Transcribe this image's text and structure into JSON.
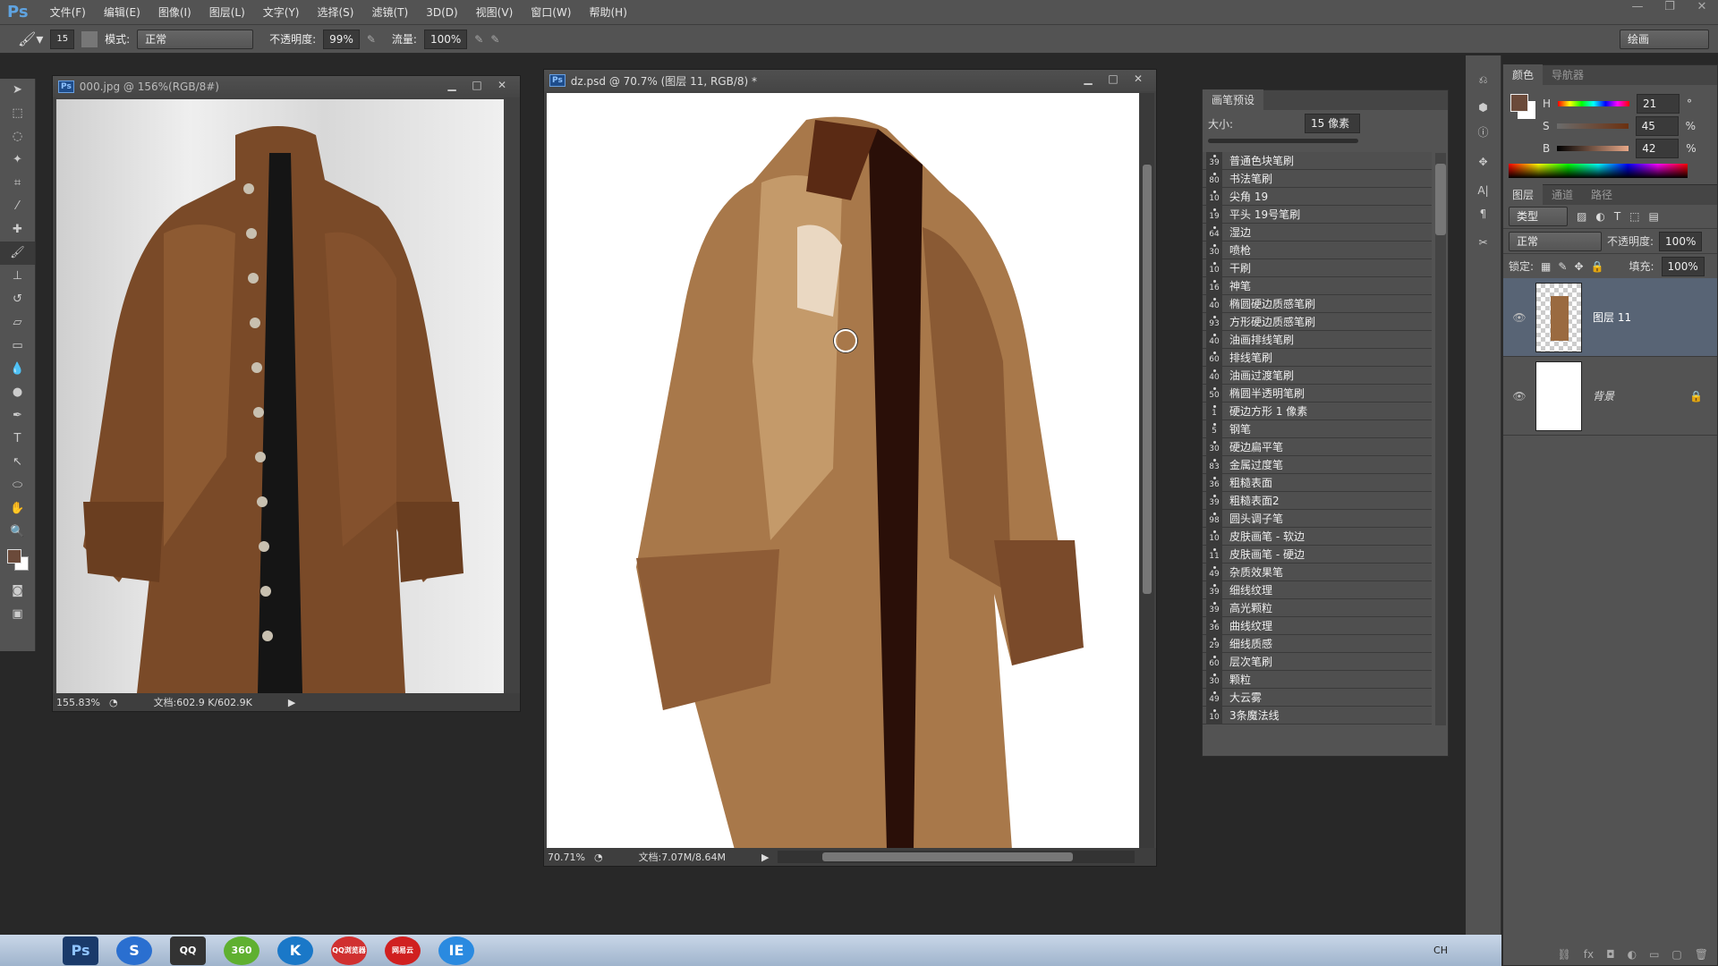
{
  "app": {
    "logo": "Ps",
    "workspace": "绘画"
  },
  "menu": [
    "文件(F)",
    "编辑(E)",
    "图像(I)",
    "图层(L)",
    "文字(Y)",
    "选择(S)",
    "滤镜(T)",
    "3D(D)",
    "视图(V)",
    "窗口(W)",
    "帮助(H)"
  ],
  "window_controls": [
    "—",
    "❐",
    "✕"
  ],
  "options": {
    "brush_size": "15",
    "mode_label": "模式:",
    "mode_value": "正常",
    "opacity_label": "不透明度:",
    "opacity_value": "99%",
    "flow_label": "流量:",
    "flow_value": "100%"
  },
  "doc1": {
    "title": "000.jpg @ 156%(RGB/8#)",
    "zoom": "155.83%",
    "doc_size": "文档:602.9 K/602.9K"
  },
  "doc2": {
    "title": "dz.psd @ 70.7% (图层 11, RGB/8) *",
    "zoom": "70.71%",
    "doc_size": "文档:7.07M/8.64M"
  },
  "brush_panel": {
    "tab": "画笔预设",
    "size_label": "大小:",
    "size_value": "15 像素",
    "items": [
      [
        "39",
        "普通色块笔刷"
      ],
      [
        "80",
        "书法笔刷"
      ],
      [
        "10",
        "尖角 19"
      ],
      [
        "19",
        "平头 19号笔刷"
      ],
      [
        "64",
        "湿边"
      ],
      [
        "30",
        "喷枪"
      ],
      [
        "10",
        "干刷"
      ],
      [
        "16",
        "神笔"
      ],
      [
        "40",
        "椭圆硬边质感笔刷"
      ],
      [
        "93",
        "方形硬边质感笔刷"
      ],
      [
        "40",
        "油画排线笔刷"
      ],
      [
        "60",
        "排线笔刷"
      ],
      [
        "40",
        "油画过渡笔刷"
      ],
      [
        "50",
        "椭圆半透明笔刷"
      ],
      [
        "1",
        "硬边方形 1 像素"
      ],
      [
        "5",
        "钢笔"
      ],
      [
        "30",
        "硬边扁平笔"
      ],
      [
        "83",
        "金属过度笔"
      ],
      [
        "36",
        "粗糙表面"
      ],
      [
        "39",
        "粗糙表面2"
      ],
      [
        "98",
        "圆头调子笔"
      ],
      [
        "10",
        "皮肤画笔 - 软边"
      ],
      [
        "11",
        "皮肤画笔 - 硬边"
      ],
      [
        "49",
        "杂质效果笔"
      ],
      [
        "39",
        "细线纹理"
      ],
      [
        "39",
        "高光颗粒"
      ],
      [
        "36",
        "曲线纹理"
      ],
      [
        "29",
        "细线质感"
      ],
      [
        "60",
        "层次笔刷"
      ],
      [
        "30",
        "颗粒"
      ],
      [
        "49",
        "大云雾"
      ],
      [
        "10",
        "3条魔法线"
      ]
    ]
  },
  "color_panel": {
    "tabs": [
      "颜色",
      "导航器"
    ],
    "h_label": "H",
    "h": "21",
    "h_unit": "°",
    "s_label": "S",
    "s": "45",
    "s_unit": "%",
    "b_label": "B",
    "b": "42",
    "b_unit": "%",
    "foreground": "#6b4a3a",
    "background": "#ffffff"
  },
  "layers_panel": {
    "tabs": [
      "图层",
      "通道",
      "路径"
    ],
    "filter": "类型",
    "blend": "正常",
    "opacity_label": "不透明度:",
    "opacity": "100%",
    "lock_label": "锁定:",
    "fill_label": "填充:",
    "fill": "100%",
    "layers": [
      {
        "name": "图层 11",
        "selected": true
      },
      {
        "name": "背景",
        "locked": true
      }
    ]
  },
  "taskbar": {
    "apps": [
      "Ps",
      "S",
      "QQ",
      "360",
      "K",
      "QQ浏览器",
      "网易云",
      "IE"
    ],
    "lang": "CH"
  }
}
